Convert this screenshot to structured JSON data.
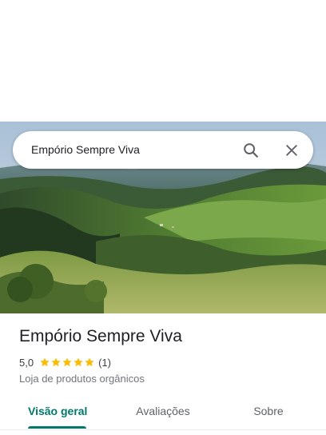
{
  "search": {
    "query": "Empório Sempre Viva"
  },
  "place": {
    "title": "Empório Sempre Viva",
    "rating": "5,0",
    "stars_filled": 5,
    "stars_total": 5,
    "review_count": "(1)",
    "category": "Loja de produtos orgânicos"
  },
  "tabs": [
    {
      "label": "Visão geral",
      "active": true
    },
    {
      "label": "Avaliações",
      "active": false
    },
    {
      "label": "Sobre",
      "active": false
    }
  ],
  "icons": {
    "search": "search-icon",
    "close": "close-icon",
    "star": "star-icon"
  },
  "colors": {
    "accent": "#00796b",
    "star": "#fbbc04",
    "title_text": "#202124",
    "secondary_text": "#70757a"
  }
}
